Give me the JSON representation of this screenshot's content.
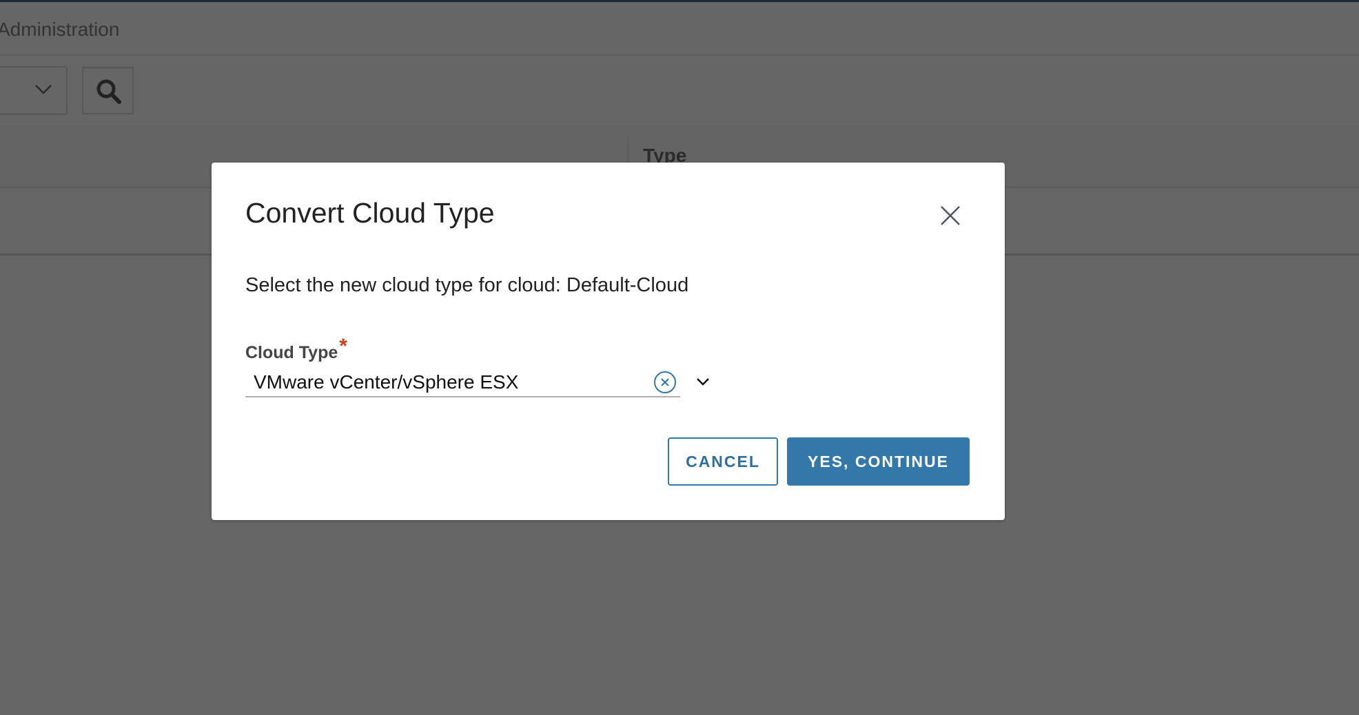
{
  "header": {
    "title": "Administration"
  },
  "table": {
    "columns": [
      "Type"
    ]
  },
  "dialog": {
    "title": "Convert Cloud Type",
    "message": "Select the new cloud type for cloud: Default-Cloud",
    "field_label": "Cloud Type",
    "required_mark": "*",
    "field_value": "VMware vCenter/vSphere ESX",
    "cancel_label": "CANCEL",
    "confirm_label": "YES, CONTINUE"
  },
  "colors": {
    "accent": "#3478a9",
    "required": "#d13b1f",
    "overlay": "#666666"
  }
}
